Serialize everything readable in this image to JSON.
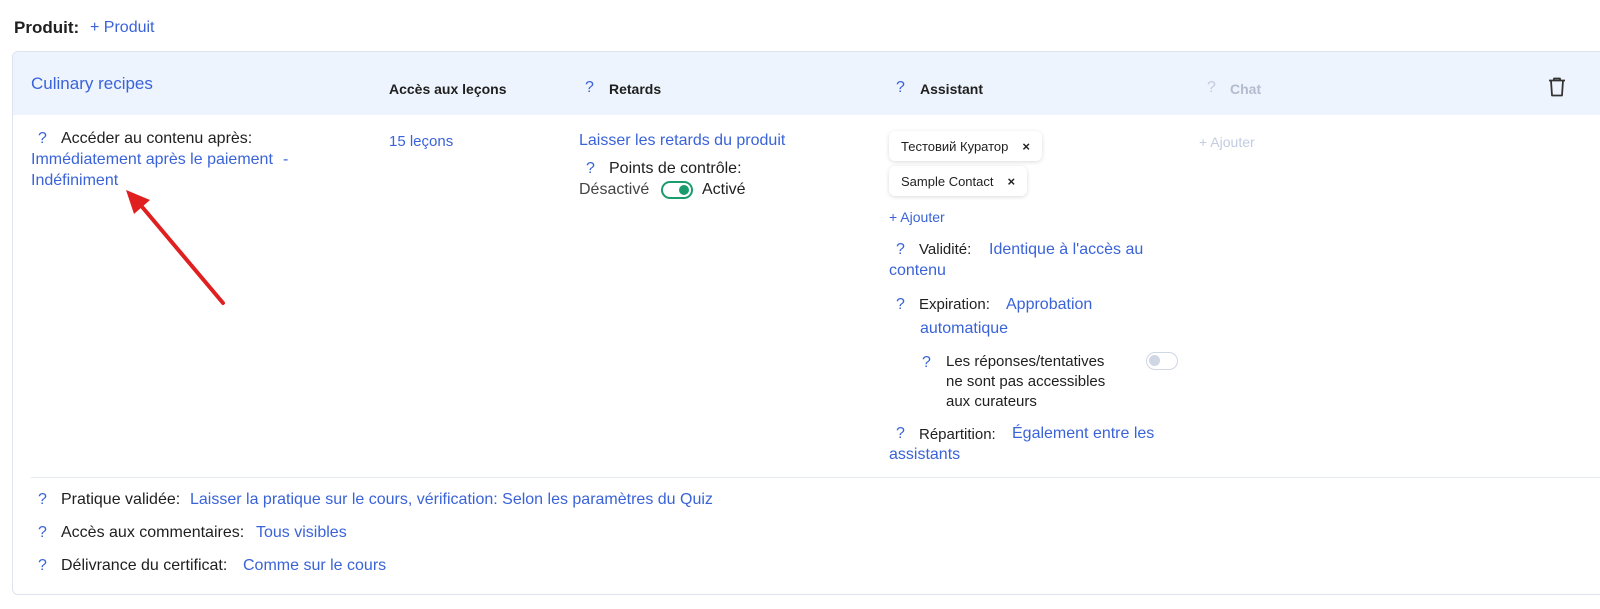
{
  "product_row": {
    "label": "Produit:",
    "add_link": "+ Produit"
  },
  "card": {
    "title": "Culinary recipes",
    "headers": {
      "lesson_access": "Accès aux leçons",
      "delays": "Retards",
      "assistant": "Assistant",
      "chat": "Chat"
    },
    "help_glyph": "?",
    "content_access": {
      "label": "Accéder au contenu après:",
      "value_line1": "Immédiatement après le paiement",
      "separator": "-",
      "value_line2": "Indéfiniment"
    },
    "lessons": {
      "value": "15 leçons"
    },
    "delays": {
      "link": "Laisser les retards du produit",
      "checkpoints_label": "Points de contrôle:",
      "off_label": "Désactivé",
      "on_label": "Activé",
      "checkpoints_enabled": true
    },
    "assistants": {
      "chips": [
        {
          "name": "Тестовий Куратор",
          "remove": "×"
        },
        {
          "name": "Sample Contact",
          "remove": "×"
        }
      ],
      "add": "+ Ajouter",
      "validity_label": "Validité:",
      "validity_value_l1": "Identique à l'accès au",
      "validity_value_l2": "contenu",
      "expiration_label": "Expiration:",
      "expiration_value_l1": "Approbation",
      "expiration_value_l2": "automatique",
      "answers_l1": "Les réponses/tentatives",
      "answers_l2": "ne sont pas accessibles",
      "answers_l3": "aux curateurs",
      "answers_enabled": false,
      "distribution_label": "Répartition:",
      "distribution_value_l1": "Également entre les",
      "distribution_value_l2": "assistants"
    },
    "chat": {
      "add": "+ Ajouter"
    },
    "footer": {
      "practice_label": "Pratique validée:",
      "practice_value": "Laisser la pratique sur le cours, vérification: Selon les paramètres du Quiz",
      "comments_label": "Accès aux commentaires:",
      "comments_value": "Tous visibles",
      "certificate_label": "Délivrance du certificat:",
      "certificate_value": "Comme sur le cours"
    }
  },
  "icons": {
    "trash": "trash-icon",
    "help": "help-icon",
    "arrow": "red-arrow-annotation"
  },
  "colors": {
    "link": "#3a63d8",
    "header_bg": "#eef4fd",
    "toggle_on": "#1a9c6c",
    "annotation": "#e02020"
  }
}
